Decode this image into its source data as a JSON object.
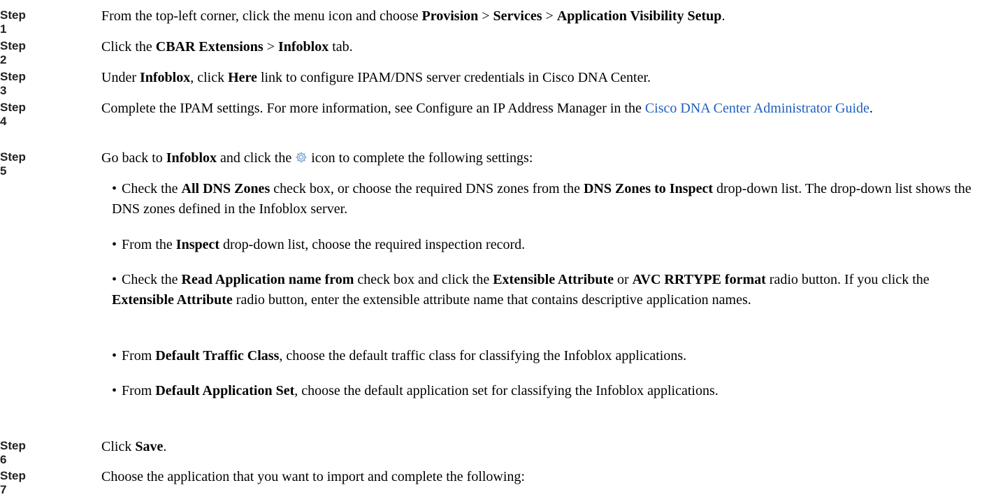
{
  "steps": [
    {
      "label": "Step 1",
      "parts": [
        "From the top-left corner, click the menu icon and choose ",
        "Provision",
        " > ",
        "Services",
        " > ",
        "Application Visibility Setup",
        "."
      ]
    },
    {
      "label": "Step 2",
      "parts": [
        "Click the ",
        "CBAR Extensions",
        " > ",
        "Infoblox",
        " tab."
      ]
    },
    {
      "label": "Step 3",
      "parts": [
        "Under ",
        "Infoblox",
        ", click ",
        "Here",
        " link to configure IPAM/DNS server credentials in Cisco DNA Center."
      ]
    },
    {
      "label": "Step 4",
      "parts": [
        "Complete the IPAM settings. For more information, see Configure an IP Address Manager in the ",
        "Cisco DNA Center Administrator Guide",
        "."
      ]
    },
    {
      "label": "Step 5",
      "parts": [
        "Go back to ",
        "Infoblox",
        " and click the ",
        " icon to complete the following settings:"
      ],
      "icon": "gear-icon",
      "bullets": [
        {
          "parts": [
            "Check the ",
            "All DNS Zones",
            " check box, or choose the required DNS zones from the ",
            "DNS Zones to Inspect",
            " drop-down list. The drop-down list shows the DNS zones defined in the Infoblox server."
          ]
        },
        {
          "parts": [
            "From the ",
            "Inspect",
            " drop-down list, choose the required inspection record."
          ]
        },
        {
          "parts": [
            "Check the ",
            "Read Application name from",
            " check box and click the ",
            "Extensible Attribute",
            " or ",
            "AVC RRTYPE format",
            " radio button. If you click the ",
            "Extensible Attribute",
            " radio button, enter the extensible attribute name that contains descriptive application names."
          ]
        },
        {
          "parts": [
            "From ",
            "Default Traffic Class",
            ", choose the default traffic class for classifying the Infoblox applications."
          ]
        },
        {
          "parts": [
            "From ",
            "Default Application Set",
            ", choose the default application set for classifying the Infoblox applications."
          ]
        }
      ]
    },
    {
      "label": "Step 6",
      "parts": [
        "Click ",
        "Save",
        "."
      ]
    },
    {
      "label": "Step 7",
      "parts": [
        "Choose the application that you want to import and complete the following:"
      ]
    }
  ],
  "colors": {
    "link": "#1f5fbf",
    "icon": "#7aa7d9"
  }
}
